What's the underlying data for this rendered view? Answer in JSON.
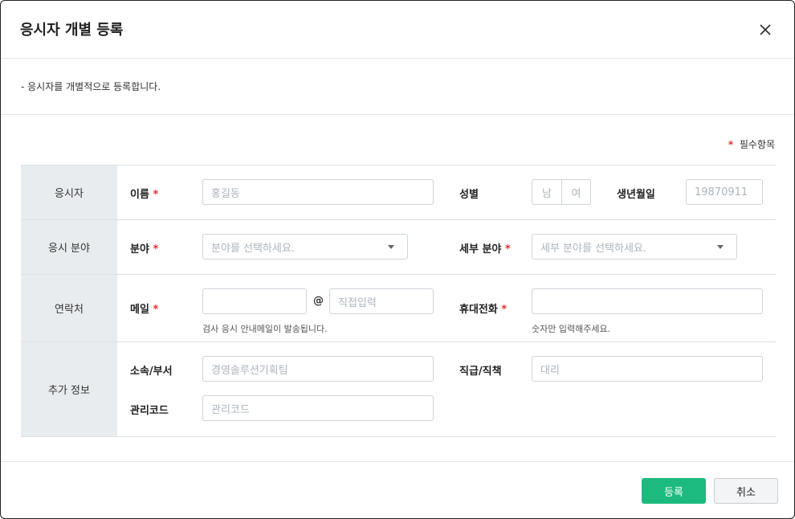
{
  "modal": {
    "title": "응시자 개별 등록",
    "description": "-  응시자를 개별적으로 등록합니다.",
    "required_star": "*",
    "required_note": "필수항목"
  },
  "sections": {
    "applicant": {
      "header": "응시자",
      "name_label": "이름",
      "name_placeholder": "홍길동",
      "gender_label": "성별",
      "gender_male": "남",
      "gender_female": "여",
      "birth_label": "생년월일",
      "birth_placeholder": "19870911"
    },
    "field": {
      "header": "응시 분야",
      "field_label": "분야",
      "field_placeholder": "분야를 선택하세요.",
      "subfield_label": "세부 분야",
      "subfield_placeholder": "세부 분야를 선택하세요."
    },
    "contact": {
      "header": "연락처",
      "email_label": "메일",
      "email_user_placeholder": "",
      "at_sign": "@",
      "email_domain_placeholder": "직접입력",
      "email_hint": "검사 응시 안내메일이 발송됩니다.",
      "phone_label": "휴대전화",
      "phone_placeholder": "",
      "phone_hint": "숫자만 입력해주세요."
    },
    "extra": {
      "header": "추가 정보",
      "dept_label": "소속/부서",
      "dept_placeholder": "경영솔루션기획팀",
      "position_label": "직급/직책",
      "position_placeholder": "대리",
      "code_label": "관리코드",
      "code_placeholder": "관리코드"
    }
  },
  "footer": {
    "submit_label": "등록",
    "cancel_label": "취소"
  },
  "colors": {
    "accent": "#1cba7f",
    "required": "#e03131",
    "section_bg": "#e9ecef"
  },
  "icons": {
    "close": "close-icon",
    "dropdown": "caret-down-icon"
  }
}
